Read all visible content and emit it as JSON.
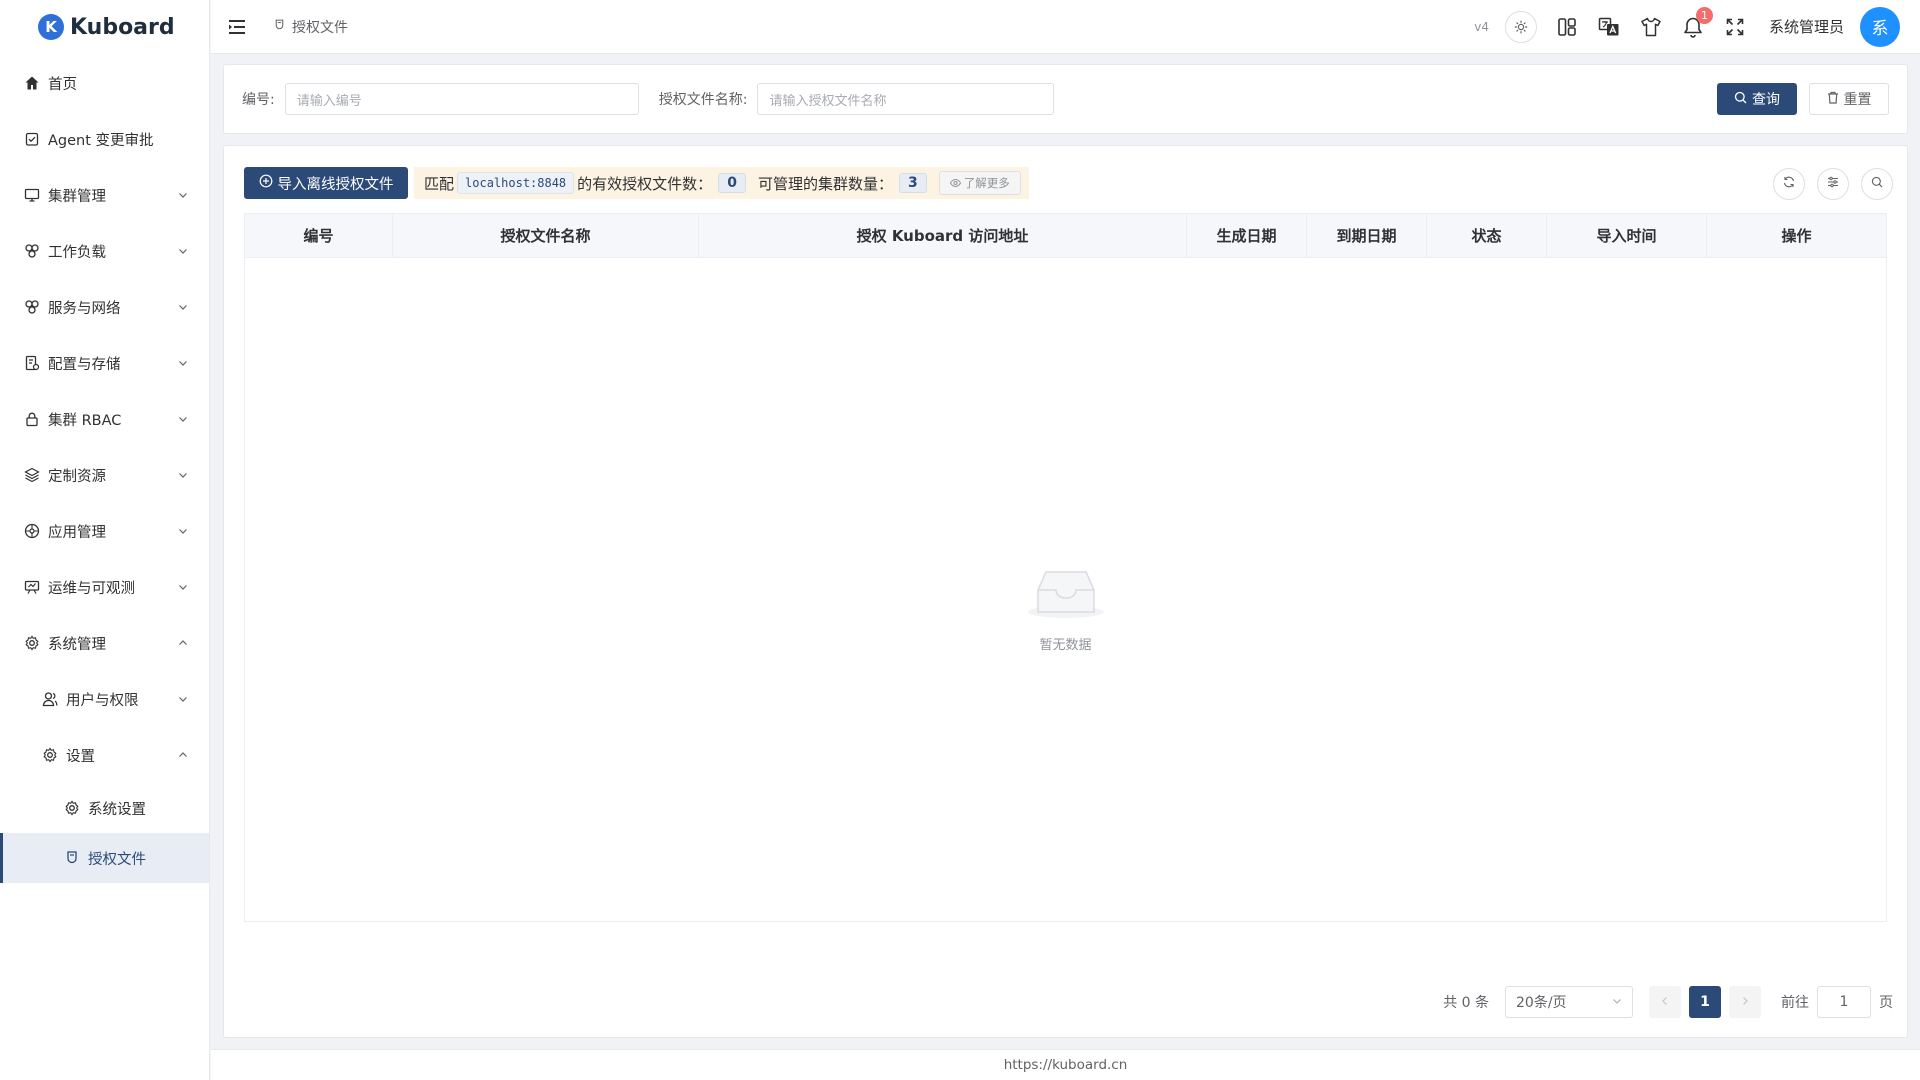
{
  "app": {
    "logo_letter": "K",
    "name": "Kuboard",
    "version": "v4"
  },
  "breadcrumb": {
    "current": "授权文件"
  },
  "user": {
    "name": "系统管理员",
    "avatar_char": "系"
  },
  "notifications": {
    "count": "1"
  },
  "sidebar": {
    "items": [
      {
        "label": "首页",
        "icon": "home-icon"
      },
      {
        "label": "Agent 变更审批",
        "icon": "approval-icon"
      },
      {
        "label": "集群管理",
        "icon": "monitor-icon"
      },
      {
        "label": "工作负载",
        "icon": "workload-icon"
      },
      {
        "label": "服务与网络",
        "icon": "network-icon"
      },
      {
        "label": "配置与存储",
        "icon": "config-icon"
      },
      {
        "label": "集群 RBAC",
        "icon": "lock-icon"
      },
      {
        "label": "定制资源",
        "icon": "layers-icon"
      },
      {
        "label": "应用管理",
        "icon": "apps-icon"
      },
      {
        "label": "运维与可观测",
        "icon": "observe-icon"
      },
      {
        "label": "系统管理",
        "icon": "gear-icon"
      },
      {
        "label": "用户与权限",
        "icon": "users-icon"
      },
      {
        "label": "设置",
        "icon": "gear-icon"
      },
      {
        "label": "系统设置",
        "icon": "gear-icon"
      },
      {
        "label": "授权文件",
        "icon": "license-icon"
      }
    ]
  },
  "search": {
    "code_label": "编号:",
    "code_placeholder": "请输入编号",
    "name_label": "授权文件名称:",
    "name_placeholder": "请输入授权文件名称",
    "query_label": "查询",
    "reset_label": "重置"
  },
  "toolbar": {
    "import_label": "导入离线授权文件",
    "match_prefix": "匹配",
    "host": "localhost:8848",
    "valid_text": "的有效授权文件数：",
    "valid_count": "0",
    "cluster_text": "可管理的集群数量：",
    "cluster_count": "3",
    "more_label": "了解更多"
  },
  "table": {
    "columns": [
      "编号",
      "授权文件名称",
      "授权 Kuboard 访问地址",
      "生成日期",
      "到期日期",
      "状态",
      "导入时间",
      "操作"
    ],
    "rows": [],
    "empty_text": "暂无数据"
  },
  "pagination": {
    "total_text": "共 0 条",
    "page_size": "20条/页",
    "current_page": "1",
    "goto_label": "前往",
    "goto_value": "1",
    "page_suffix": "页"
  },
  "footer": {
    "text": "https://kuboard.cn"
  },
  "colors": {
    "primary": "#2c4a78",
    "avatar": "#1e90ff",
    "badge": "#f56c6c",
    "highlight": "#fdf3e3"
  }
}
